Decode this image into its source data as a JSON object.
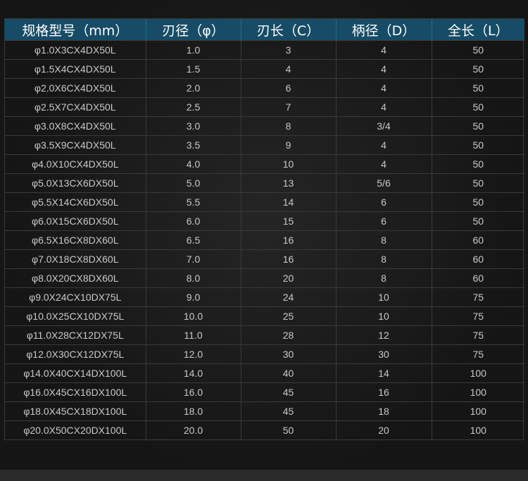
{
  "table": {
    "headers": [
      "规格型号（mm）",
      "刃径（φ）",
      "刃长（C）",
      "柄径（D）",
      "全长（L）"
    ],
    "rows": [
      [
        "φ1.0X3CX4DX50L",
        "1.0",
        "3",
        "4",
        "50"
      ],
      [
        "φ1.5X4CX4DX50L",
        "1.5",
        "4",
        "4",
        "50"
      ],
      [
        "φ2.0X6CX4DX50L",
        "2.0",
        "6",
        "4",
        "50"
      ],
      [
        "φ2.5X7CX4DX50L",
        "2.5",
        "7",
        "4",
        "50"
      ],
      [
        "φ3.0X8CX4DX50L",
        "3.0",
        "8",
        "3/4",
        "50"
      ],
      [
        "φ3.5X9CX4DX50L",
        "3.5",
        "9",
        "4",
        "50"
      ],
      [
        "φ4.0X10CX4DX50L",
        "4.0",
        "10",
        "4",
        "50"
      ],
      [
        "φ5.0X13CX6DX50L",
        "5.0",
        "13",
        "5/6",
        "50"
      ],
      [
        "φ5.5X14CX6DX50L",
        "5.5",
        "14",
        "6",
        "50"
      ],
      [
        "φ6.0X15CX6DX50L",
        "6.0",
        "15",
        "6",
        "50"
      ],
      [
        "φ6.5X16CX8DX60L",
        "6.5",
        "16",
        "8",
        "60"
      ],
      [
        "φ7.0X18CX8DX60L",
        "7.0",
        "16",
        "8",
        "60"
      ],
      [
        "φ8.0X20CX8DX60L",
        "8.0",
        "20",
        "8",
        "60"
      ],
      [
        "φ9.0X24CX10DX75L",
        "9.0",
        "24",
        "10",
        "75"
      ],
      [
        "φ10.0X25CX10DX75L",
        "10.0",
        "25",
        "10",
        "75"
      ],
      [
        "φ11.0X28CX12DX75L",
        "11.0",
        "28",
        "12",
        "75"
      ],
      [
        "φ12.0X30CX12DX75L",
        "12.0",
        "30",
        "30",
        "75"
      ],
      [
        "φ14.0X40CX14DX100L",
        "14.0",
        "40",
        "14",
        "100"
      ],
      [
        "φ16.0X45CX16DX100L",
        "16.0",
        "45",
        "16",
        "100"
      ],
      [
        "φ18.0X45CX18DX100L",
        "18.0",
        "45",
        "18",
        "100"
      ],
      [
        "φ20.0X50CX20DX100L",
        "20.0",
        "50",
        "20",
        "100"
      ]
    ]
  },
  "colors": {
    "header_bg": "#174c66",
    "header_text": "#ffffff",
    "cell_text": "#c9c9c9",
    "grid_line": "#3a3a3a",
    "page_bg": "#151515"
  }
}
